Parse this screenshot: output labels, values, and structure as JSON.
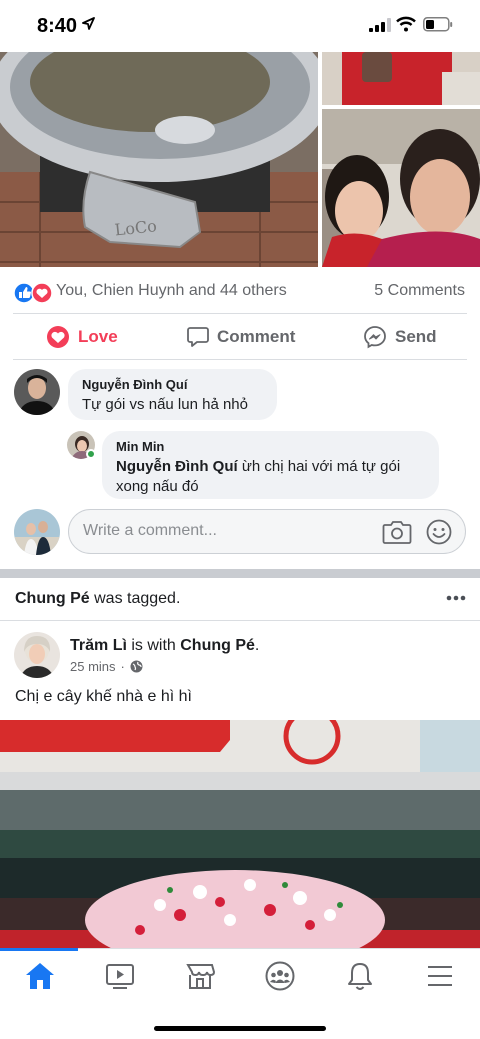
{
  "status_bar": {
    "time": "8:40"
  },
  "reactions": {
    "summary": "You, Chien Huynh and 44 others",
    "comments_count": "5 Comments"
  },
  "actions": {
    "love": "Love",
    "comment": "Comment",
    "send": "Send"
  },
  "comments": [
    {
      "author": "Nguyễn Đình Quí",
      "text": "Tự gói vs nấu lun hả nhỏ"
    },
    {
      "author": "Min Min",
      "mention": "Nguyễn Đình Quí",
      "text": " ừh chị hai với má tự gói xong nấu đó"
    }
  ],
  "write_comment": {
    "placeholder": "Write a comment..."
  },
  "tagged": {
    "name": "Chung Pé",
    "suffix": " was tagged."
  },
  "post": {
    "author": "Trăm Lì",
    "with_text": " is with ",
    "with_name": "Chung Pé",
    "end": ".",
    "time": "25 mins",
    "separator": "·",
    "text": "Chị e cây khế nhà e hì hì"
  },
  "colors": {
    "accent": "#1877f2",
    "love": "#f33e58",
    "muted": "#65676b"
  },
  "tab_bar": {
    "items": [
      "home-icon",
      "watch-icon",
      "marketplace-icon",
      "groups-icon",
      "notifications-icon",
      "menu-icon"
    ],
    "active": "home-icon"
  }
}
